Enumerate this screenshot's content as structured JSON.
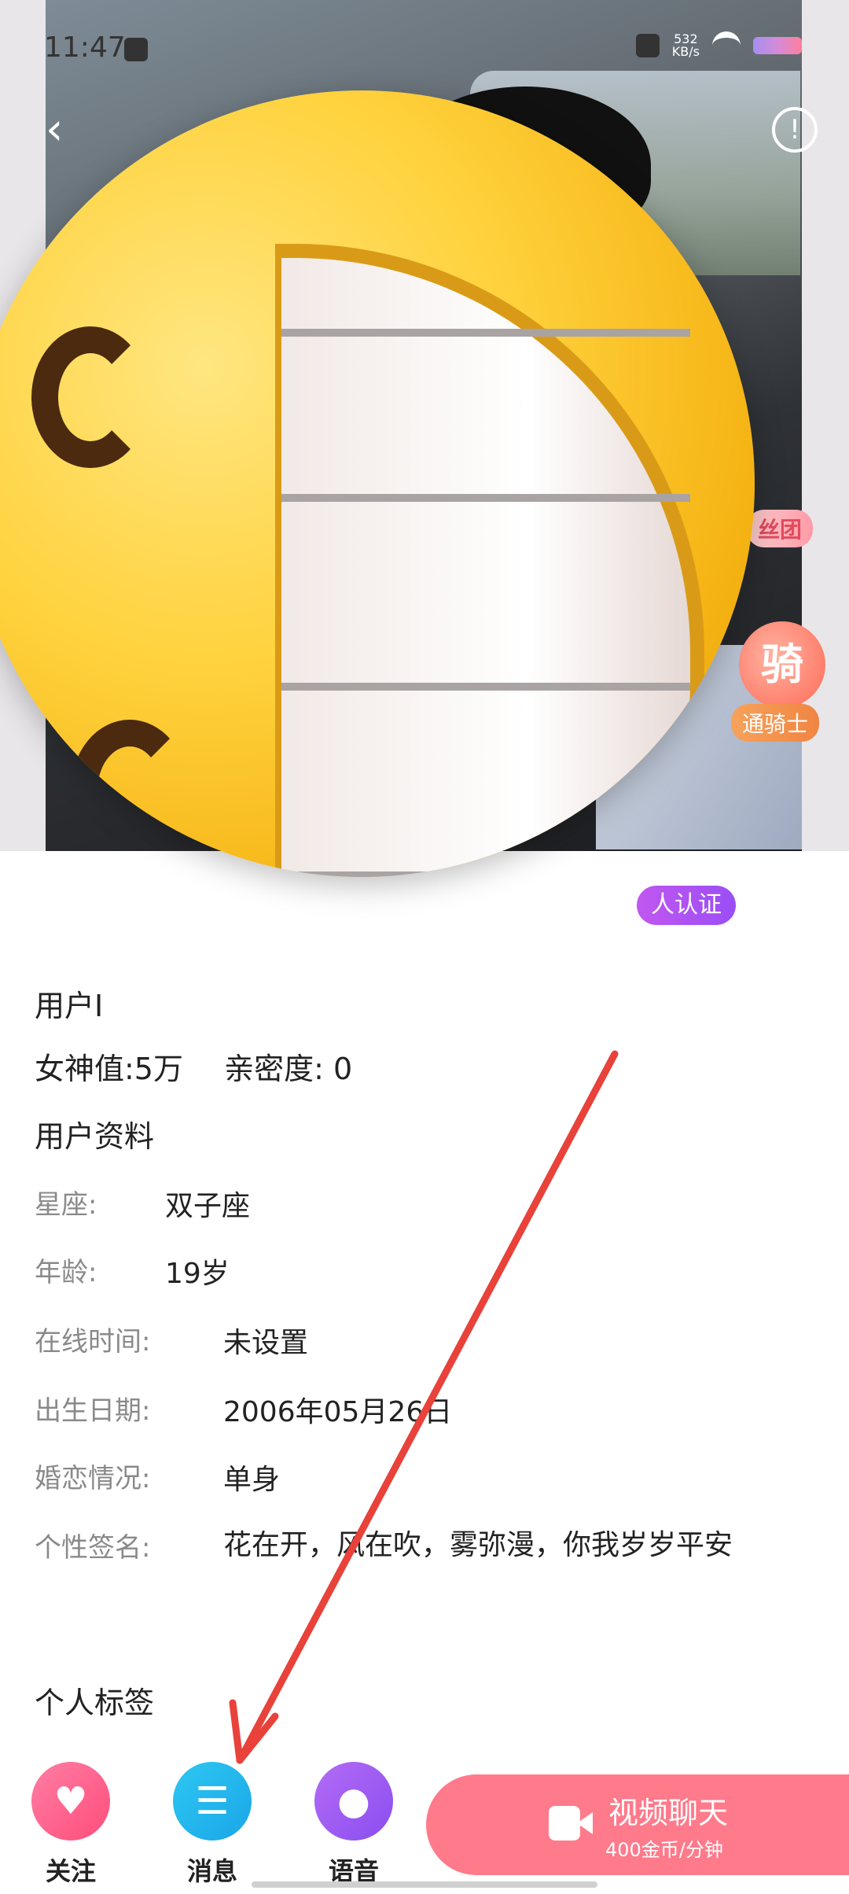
{
  "status_bar": {
    "time": "11:47",
    "net_speed_value": "532",
    "net_speed_unit": "KB/s"
  },
  "photo": {
    "badge_fans": "丝团",
    "badge_knight_glyph": "骑",
    "badge_knight": "通骑士",
    "cert_badge": "人认证"
  },
  "profile": {
    "user_id_label": "用户I",
    "goddess_value": "女神值:5万",
    "intimacy": "亲密度: 0",
    "profile_title": "用户资料",
    "rows": [
      {
        "label": "星座:",
        "value": "双子座"
      },
      {
        "label": "年龄:",
        "value": "19岁"
      },
      {
        "label": "在线时间:",
        "value": "未设置"
      },
      {
        "label": "出生日期:",
        "value": "2006年05月26日"
      },
      {
        "label": "婚恋情况:",
        "value": "单身"
      },
      {
        "label": "个性签名:",
        "value": "花在开，风在吹，雾弥漫，你我岁岁平安"
      }
    ],
    "tags_title": "个人标签"
  },
  "bottom_bar": {
    "follow_label": "关注",
    "message_label": "消息",
    "voice_label": "语音",
    "video_chat_title": "视频聊天",
    "video_chat_price": "400金币/分钟"
  },
  "icons": {
    "follow": "heart-plus-icon",
    "message": "chat-bubble-icon",
    "voice": "microphone-icon",
    "video": "video-camera-icon",
    "back": "chevron-left-icon",
    "more": "info-icon"
  },
  "colors": {
    "follow": "#ff4d7c",
    "message": "#1aa6e8",
    "voice": "#8a4df0",
    "video_chat": "#ff7a8b",
    "annotation_arrow": "#e8423a"
  }
}
